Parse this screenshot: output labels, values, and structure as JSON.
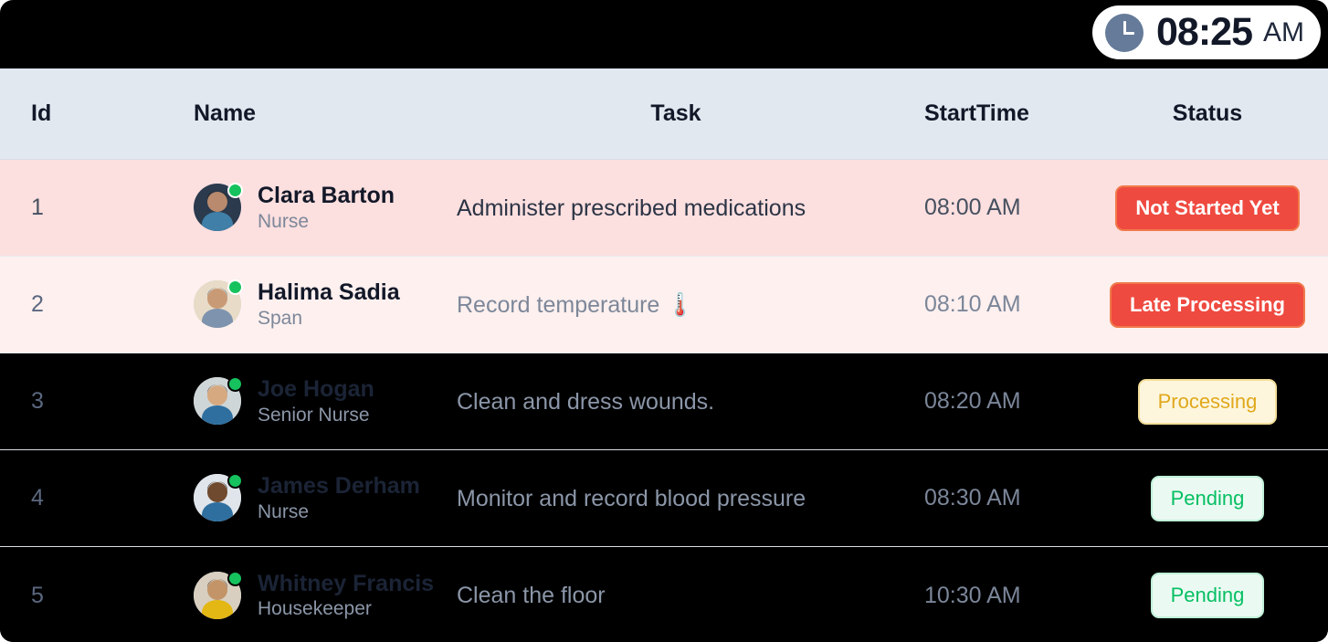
{
  "clock": {
    "icon": "clock-icon",
    "time": "08:25",
    "ampm": "AM"
  },
  "table": {
    "columns": {
      "id": "Id",
      "name": "Name",
      "task": "Task",
      "start_time": "StartTime",
      "status": "Status"
    },
    "rows": [
      {
        "id": "1",
        "name": "Clara Barton",
        "role": "Nurse",
        "task": "Administer prescribed medications",
        "start_time": "08:00 AM",
        "status": "Not Started Yet",
        "status_style": "red",
        "row_style": "pink",
        "presence": "online"
      },
      {
        "id": "2",
        "name": "Halima Sadia",
        "role": "Span",
        "task": "Record temperature 🌡️",
        "start_time": "08:10 AM",
        "status": "Late Processing",
        "status_style": "red",
        "row_style": "pink-soft",
        "presence": "online"
      },
      {
        "id": "3",
        "name": "Joe Hogan",
        "role": "Senior Nurse",
        "task": "Clean and dress wounds.",
        "start_time": "08:20 AM",
        "status": "Processing",
        "status_style": "amber",
        "row_style": "dark",
        "presence": "online"
      },
      {
        "id": "4",
        "name": "James Derham",
        "role": "Nurse",
        "task": "Monitor and record blood pressure",
        "start_time": "08:30 AM",
        "status": "Pending",
        "status_style": "green",
        "row_style": "dark",
        "presence": "online"
      },
      {
        "id": "5",
        "name": "Whitney Francis",
        "role": "Housekeeper",
        "task": "Clean the floor",
        "start_time": "10:30 AM",
        "status": "Pending",
        "status_style": "green",
        "row_style": "dark",
        "presence": "online"
      }
    ]
  },
  "colors": {
    "topbar": "#000000",
    "header_bg": "#e2e8f0",
    "row_pink": "#fcdfdf",
    "row_pink_soft": "#fdf0ef",
    "row_dark": "#000000",
    "badge_red": "#ef4a40",
    "badge_amber_text": "#e0a81b",
    "badge_green_text": "#06bf63",
    "presence_green": "#16c25d"
  }
}
